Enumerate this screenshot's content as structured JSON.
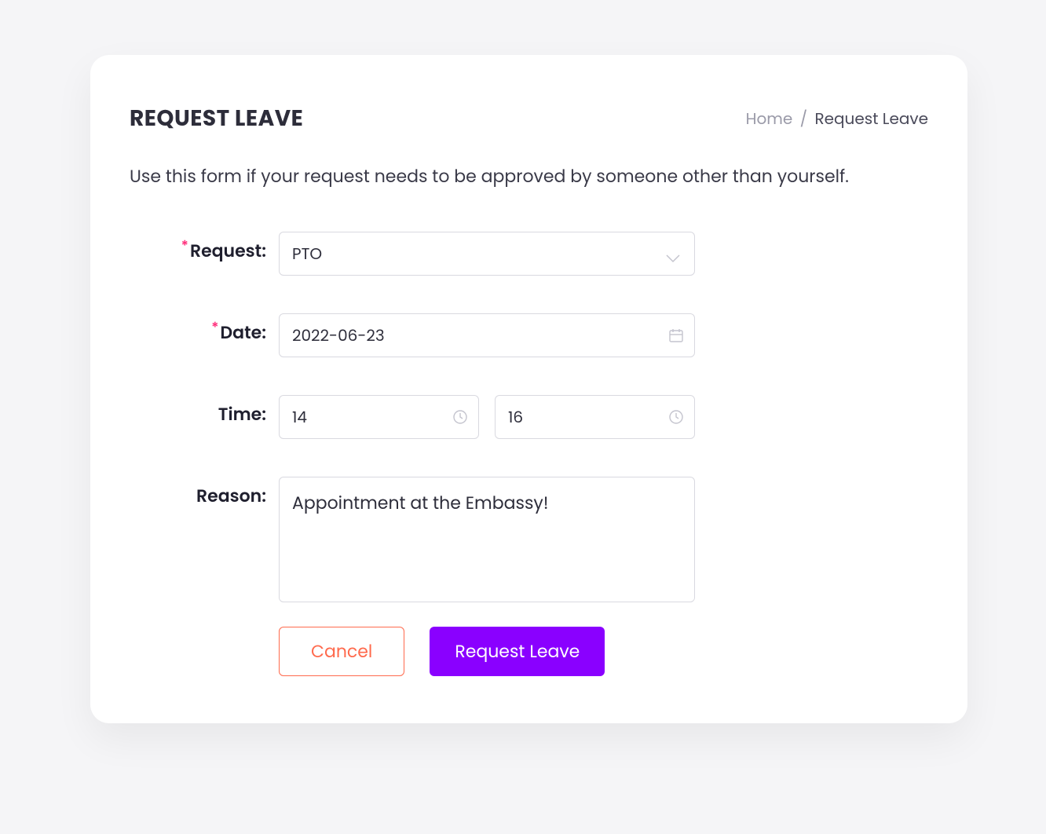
{
  "header": {
    "title": "REQUEST LEAVE"
  },
  "breadcrumb": {
    "home": "Home",
    "separator": "/",
    "current": "Request Leave"
  },
  "description": "Use this form if your request needs to be approved by someone other than yourself.",
  "form": {
    "required_mark": "*",
    "request": {
      "label": "Request:",
      "value": "PTO"
    },
    "date": {
      "label": "Date:",
      "value": "2022-06-23"
    },
    "time": {
      "label": "Time:",
      "start": "14",
      "end": "16"
    },
    "reason": {
      "label": "Reason:",
      "value": "Appointment at the Embassy!"
    }
  },
  "buttons": {
    "cancel": "Cancel",
    "submit": "Request Leave"
  }
}
